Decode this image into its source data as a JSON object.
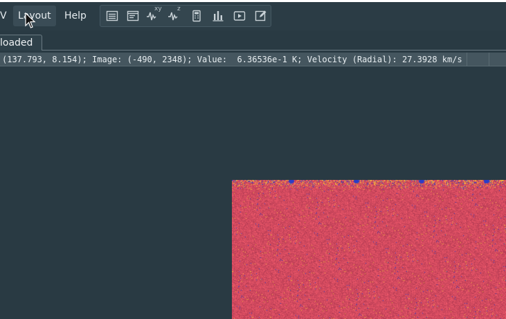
{
  "menubar": {
    "prev_label": "View",
    "layout_label": "Layout",
    "help_label": "Help"
  },
  "toolbar": {
    "tools": [
      {
        "name": "table-icon"
      },
      {
        "name": "file-header-icon"
      },
      {
        "name": "spatial-profile-icon",
        "sup": "xy"
      },
      {
        "name": "spectral-profile-icon",
        "sup": "z"
      },
      {
        "name": "calculator-icon"
      },
      {
        "name": "histogram-icon"
      },
      {
        "name": "animator-play-icon"
      },
      {
        "name": "edit-region-icon"
      }
    ]
  },
  "tab": {
    "label": "loaded"
  },
  "cursor_info": {
    "text": "(137.793, 8.154); Image: (-490, 2348); Value:  6.36536e-1 K; Velocity (Radial): 27.3928 km/s"
  },
  "colors": {
    "background": "#293a43",
    "image_base": "#d24a5f",
    "noise_blue": "#2a3cc8",
    "noise_yellow": "#f0b43c"
  }
}
